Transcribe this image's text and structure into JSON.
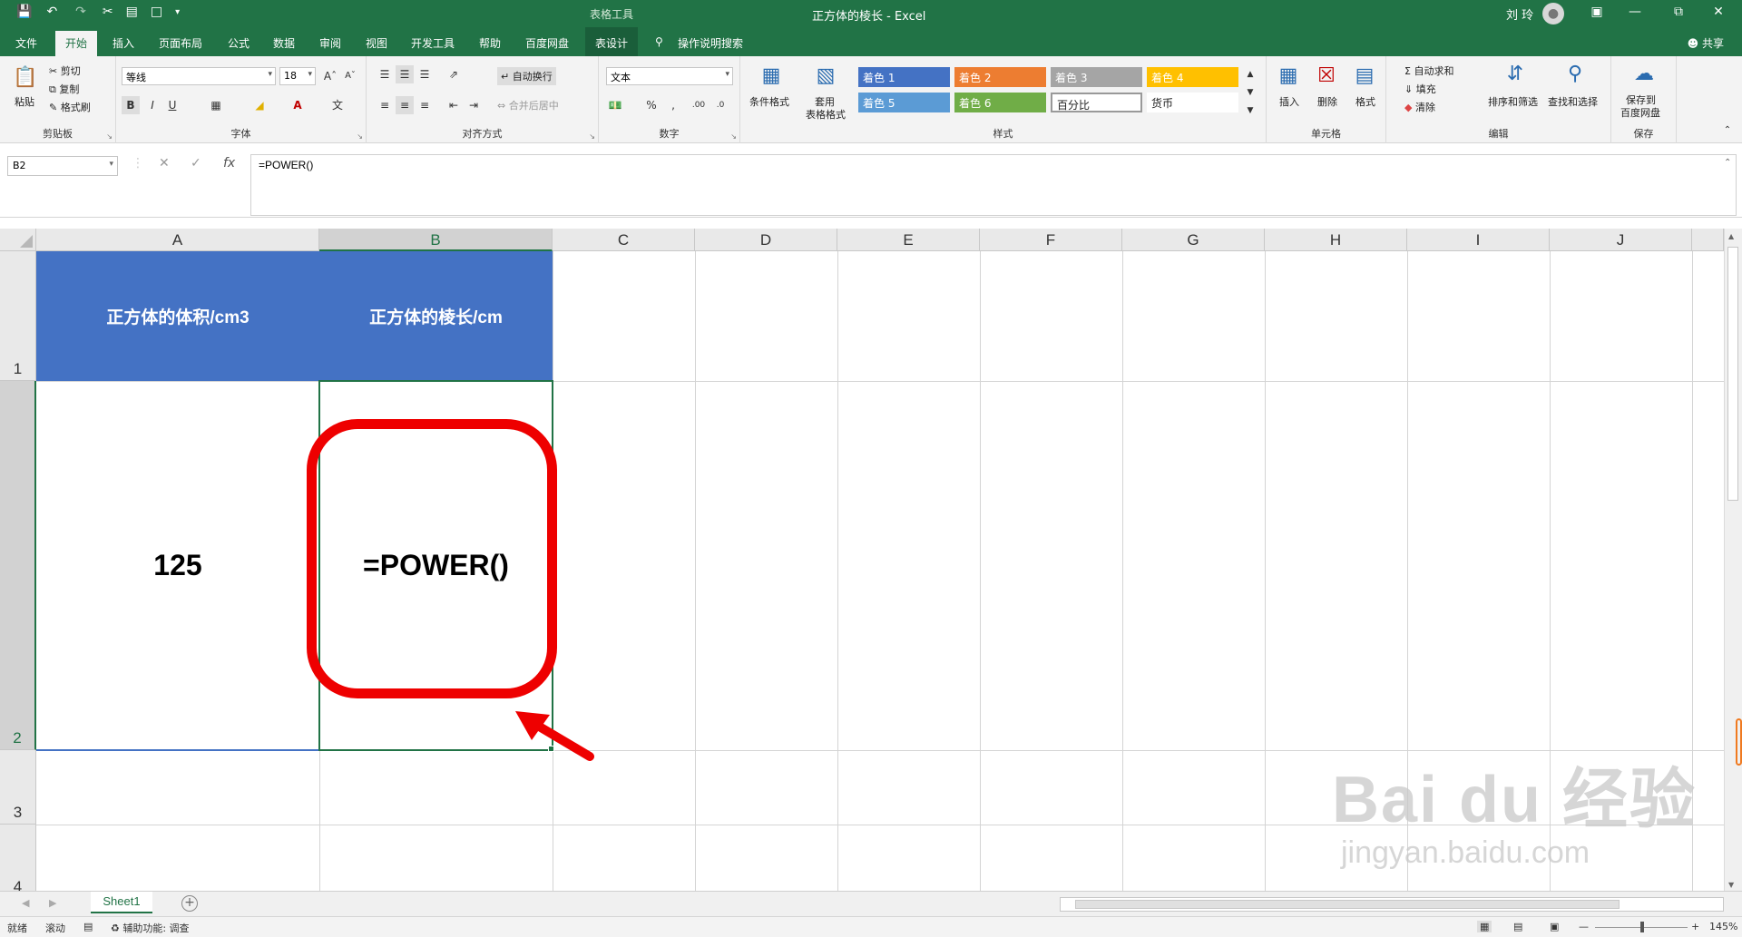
{
  "titlebar": {
    "context_tool": "表格工具",
    "title": "正方体的棱长  -  Excel",
    "user": "刘 玲"
  },
  "tabs": [
    "文件",
    "开始",
    "插入",
    "页面布局",
    "公式",
    "数据",
    "审阅",
    "视图",
    "开发工具",
    "帮助",
    "百度网盘",
    "表设计"
  ],
  "tell_me": "操作说明搜索",
  "share": "共享",
  "ribbon": {
    "clipboard": {
      "paste": "粘贴",
      "cut": "剪切",
      "copy": "复制",
      "format_painter": "格式刷",
      "label": "剪贴板"
    },
    "font": {
      "name": "等线",
      "size": "18",
      "label": "字体"
    },
    "align": {
      "wrap": "自动换行",
      "merge": "合并后居中",
      "label": "对齐方式"
    },
    "number": {
      "format": "文本",
      "label": "数字"
    },
    "styles": {
      "cond_format": "条件格式",
      "table_format_1": "套用",
      "table_format_2": "表格格式",
      "cells": [
        "着色 1",
        "着色 2",
        "着色 3",
        "着色 4",
        "着色 5",
        "着色 6",
        "百分比",
        "货币"
      ],
      "label": "样式"
    },
    "cells": {
      "insert": "插入",
      "delete": "删除",
      "format": "格式",
      "label": "单元格"
    },
    "editing": {
      "autosum": "自动求和",
      "fill": "填充",
      "clear": "清除",
      "sort": "排序和筛选",
      "find": "查找和选择",
      "label": "编辑"
    },
    "save": {
      "line1": "保存到",
      "line2": "百度网盘",
      "label": "保存"
    }
  },
  "formula_bar": {
    "name_box": "B2",
    "formula": "=POWER()"
  },
  "columns": [
    "A",
    "B",
    "C",
    "D",
    "E",
    "F",
    "G",
    "H",
    "I",
    "J"
  ],
  "rows": [
    "1",
    "2",
    "3",
    "4"
  ],
  "cells": {
    "A1": "正方体的体积/cm3",
    "B1": "正方体的棱长/cm",
    "A2": "125",
    "B2": "=POWER()"
  },
  "sheet_tab": "Sheet1",
  "status": {
    "ready": "就绪",
    "scroll": "滚动",
    "accessibility": "辅助功能: 调查",
    "zoom": "145%"
  },
  "watermark": {
    "line1": "Bai du 经验",
    "line2": "jingyan.baidu.com"
  },
  "colors": {
    "excel_green": "#217346",
    "header_fill": "#4472c4",
    "annotation_red": "#ee0000"
  }
}
